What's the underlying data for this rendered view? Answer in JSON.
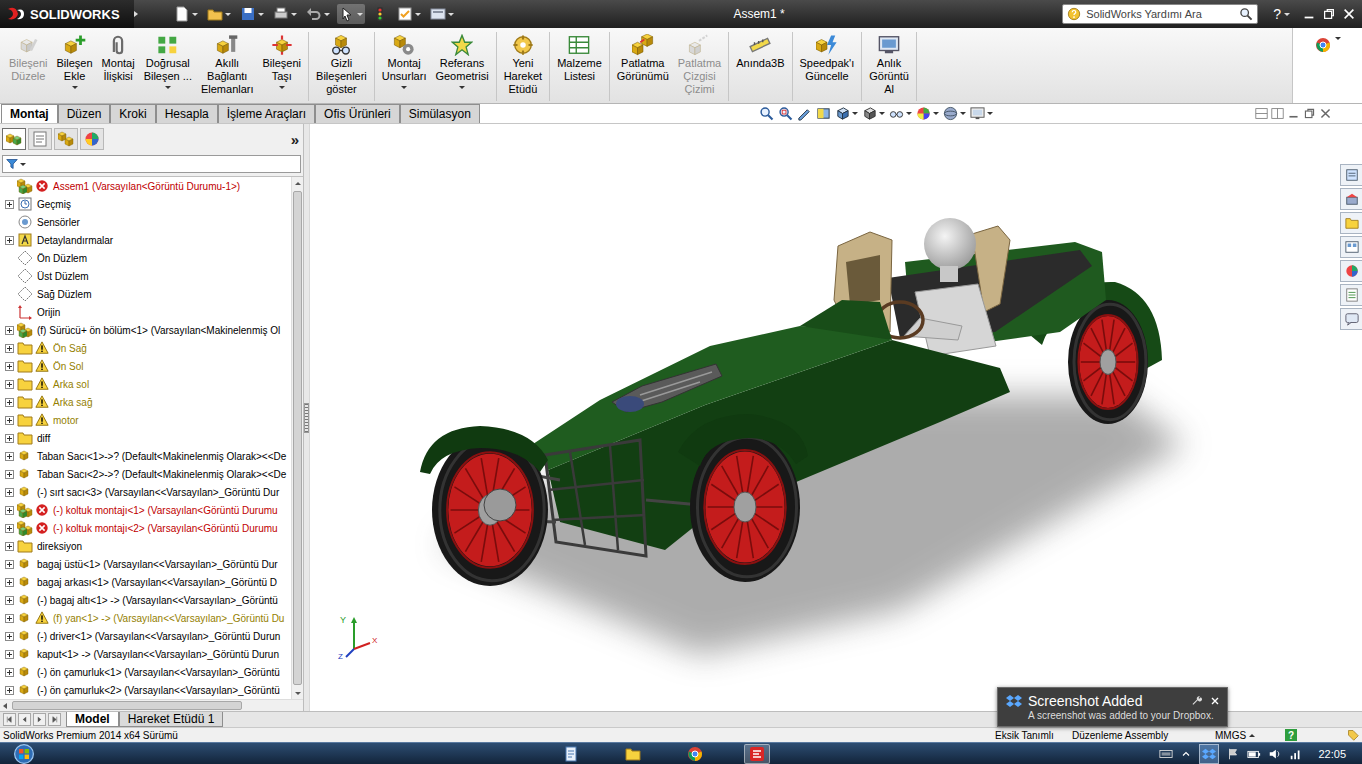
{
  "app": {
    "logo": "SOLIDWORKS",
    "title": "Assem1 *",
    "search_placeholder": "SolidWorks Yardımı Ara",
    "help": "?"
  },
  "ribbon": {
    "groups": [
      [
        {
          "lines": [
            "Bileşeni",
            "Düzele"
          ],
          "disabled": true,
          "dropdown": false
        },
        {
          "lines": [
            "Bileşen",
            "Ekle"
          ],
          "disabled": false,
          "dropdown": true
        },
        {
          "lines": [
            "Montaj",
            "İlişkisi"
          ],
          "disabled": false,
          "dropdown": false
        },
        {
          "lines": [
            "Doğrusal",
            "Bileşen ..."
          ],
          "disabled": false,
          "dropdown": true
        },
        {
          "lines": [
            "Akıllı",
            "Bağlantı",
            "Elemanları"
          ],
          "disabled": false,
          "dropdown": false
        },
        {
          "lines": [
            "Bileşeni",
            "Taşı"
          ],
          "disabled": false,
          "dropdown": true
        }
      ],
      [
        {
          "lines": [
            "Gizli",
            "Bileşenleri",
            "göster"
          ],
          "disabled": false,
          "dropdown": false
        }
      ],
      [
        {
          "lines": [
            "Montaj",
            "Unsurları"
          ],
          "disabled": false,
          "dropdown": true
        },
        {
          "lines": [
            "Referans",
            "Geometrisi"
          ],
          "disabled": false,
          "dropdown": true
        }
      ],
      [
        {
          "lines": [
            "Yeni",
            "Hareket",
            "Etüdü"
          ],
          "disabled": false,
          "dropdown": false
        }
      ],
      [
        {
          "lines": [
            "Malzeme",
            "Listesi"
          ],
          "disabled": false,
          "dropdown": false
        }
      ],
      [
        {
          "lines": [
            "Patlatma",
            "Görünümü"
          ],
          "disabled": false,
          "dropdown": false
        },
        {
          "lines": [
            "Patlatma",
            "Çizgisi",
            "Çizimi"
          ],
          "disabled": true,
          "dropdown": false
        }
      ],
      [
        {
          "lines": [
            "Anında3B"
          ],
          "disabled": false,
          "dropdown": false
        }
      ],
      [
        {
          "lines": [
            "Speedpak'ı",
            "Güncelle"
          ],
          "disabled": false,
          "dropdown": false
        }
      ],
      [
        {
          "lines": [
            "Anlık",
            "Görüntü",
            "Al"
          ],
          "disabled": false,
          "dropdown": false
        }
      ]
    ]
  },
  "tabs": [
    {
      "label": "Montaj",
      "selected": true
    },
    {
      "label": "Düzen",
      "selected": false
    },
    {
      "label": "Kroki",
      "selected": false
    },
    {
      "label": "Hesapla",
      "selected": false
    },
    {
      "label": "İşleme Araçları",
      "selected": false
    },
    {
      "label": "Ofis Ürünleri",
      "selected": false
    },
    {
      "label": "Simülasyon",
      "selected": false
    }
  ],
  "feature_manager": {
    "more": "»",
    "tabs": [
      {
        "selected": true
      },
      {
        "selected": false
      },
      {
        "selected": false
      },
      {
        "selected": false
      }
    ],
    "items": [
      {
        "label": "Assem1 (Varsayılan<Görüntü Durumu-1>)",
        "kind": "assembly",
        "expandable": false,
        "status": "error"
      },
      {
        "label": "Geçmiş",
        "kind": "history",
        "expandable": true,
        "status": "ok"
      },
      {
        "label": "Sensörler",
        "kind": "sensor",
        "expandable": false,
        "status": "ok"
      },
      {
        "label": "Detaylandırmalar",
        "kind": "annotation",
        "expandable": true,
        "status": "ok"
      },
      {
        "label": "Ön Düzlem",
        "kind": "plane",
        "expandable": false,
        "status": "ok"
      },
      {
        "label": "Üst Düzlem",
        "kind": "plane",
        "expandable": false,
        "status": "ok"
      },
      {
        "label": "Sağ Düzlem",
        "kind": "plane",
        "expandable": false,
        "status": "ok"
      },
      {
        "label": "Orijin",
        "kind": "origin",
        "expandable": false,
        "status": "ok"
      },
      {
        "label": "(f) Sürücü+ ön bölüm<1> (Varsayılan<Makinelenmiş Ol",
        "kind": "assembly",
        "expandable": true,
        "status": "ok"
      },
      {
        "label": "Ön Sağ",
        "kind": "folder",
        "expandable": true,
        "status": "warning"
      },
      {
        "label": "Ön Sol",
        "kind": "folder",
        "expandable": true,
        "status": "warning"
      },
      {
        "label": "Arka sol",
        "kind": "folder",
        "expandable": true,
        "status": "warning"
      },
      {
        "label": "Arka sağ",
        "kind": "folder",
        "expandable": true,
        "status": "warning"
      },
      {
        "label": "motor",
        "kind": "folder",
        "expandable": true,
        "status": "warning"
      },
      {
        "label": "diff",
        "kind": "folder",
        "expandable": true,
        "status": "ok"
      },
      {
        "label": "Taban Sacı<1>->? (Default<Makinelenmiş Olarak><<De",
        "kind": "part",
        "expandable": true,
        "status": "ok"
      },
      {
        "label": "Taban Sacı<2>->? (Default<Makinelenmiş Olarak><<De",
        "kind": "part",
        "expandable": true,
        "status": "ok"
      },
      {
        "label": "(-) sırt sacı<3> (Varsayılan<<Varsayılan>_Görüntü Dur",
        "kind": "part",
        "expandable": true,
        "status": "ok"
      },
      {
        "label": "(-) koltuk montajı<1> (Varsayılan<Görüntü Durumu",
        "kind": "assembly",
        "expandable": true,
        "status": "error"
      },
      {
        "label": "(-) koltuk montajı<2> (Varsayılan<Görüntü Durumu",
        "kind": "assembly",
        "expandable": true,
        "status": "error"
      },
      {
        "label": "direksiyon",
        "kind": "folder",
        "expandable": true,
        "status": "ok"
      },
      {
        "label": "bagaj üstü<1> (Varsayılan<<Varsayılan>_Görüntü Dur",
        "kind": "part",
        "expandable": true,
        "status": "ok"
      },
      {
        "label": "bagaj arkası<1> (Varsayılan<<Varsayılan>_Görüntü D",
        "kind": "part",
        "expandable": true,
        "status": "ok"
      },
      {
        "label": "(-) bagaj altı<1> -> (Varsayılan<<Varsayılan>_Görüntü",
        "kind": "part",
        "expandable": true,
        "status": "ok"
      },
      {
        "label": "(f) yan<1> -> (Varsayılan<<Varsayılan>_Görüntü Du",
        "kind": "part",
        "expandable": true,
        "status": "warning"
      },
      {
        "label": "(-) driver<1> (Varsayılan<<Varsayılan>_Görüntü Durun",
        "kind": "part",
        "expandable": true,
        "status": "ok"
      },
      {
        "label": "kaput<1> -> (Varsayılan<<Varsayılan>_Görüntü Durun",
        "kind": "part",
        "expandable": true,
        "status": "ok"
      },
      {
        "label": "(-) ön çamurluk<1> (Varsayılan<<Varsayılan>_Görüntü",
        "kind": "part",
        "expandable": true,
        "status": "ok"
      },
      {
        "label": "(-) ön çamurluk<2> (Varsayılan<<Varsayılan>_Görüntü",
        "kind": "part",
        "expandable": true,
        "status": "ok"
      }
    ]
  },
  "triad": {
    "labels": [
      "Y",
      "X",
      "Z"
    ]
  },
  "bottom_tabs": [
    {
      "label": "Model",
      "selected": true
    },
    {
      "label": "Hareket Etüdü 1",
      "selected": false
    }
  ],
  "status_bar": {
    "product": "SolidWorks Premium 2014 x64 Sürümü",
    "fields": [
      "Eksik Tanımlı",
      "Düzenleme Assembly",
      "MMGS"
    ],
    "help": "?"
  },
  "notification": {
    "title": "Screenshot Added",
    "message": "A screenshot was added to your Dropbox."
  },
  "taskbar": {
    "time": "22:05",
    "apps": [
      {
        "active": false
      },
      {
        "active": false
      },
      {
        "active": false
      },
      {
        "active": true
      }
    ]
  }
}
